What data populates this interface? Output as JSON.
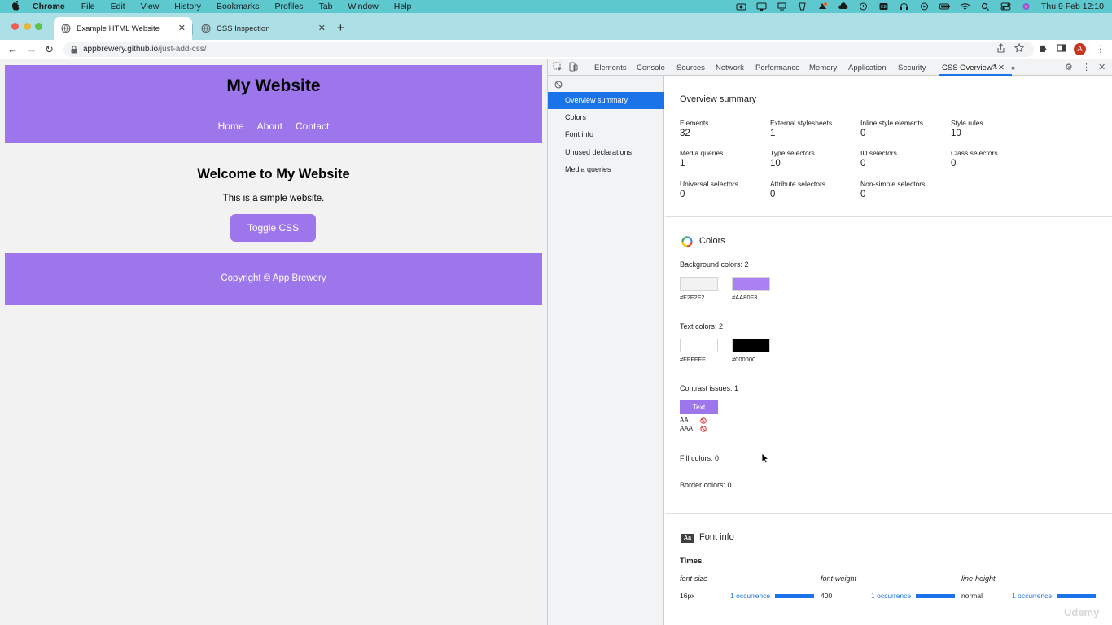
{
  "menubar": {
    "app_name": "Chrome",
    "items": [
      "File",
      "Edit",
      "View",
      "History",
      "Bookmarks",
      "Profiles",
      "Tab",
      "Window",
      "Help"
    ],
    "datetime": "Thu 9 Feb  12:10"
  },
  "browser": {
    "tabs": [
      {
        "title": "Example HTML Website",
        "active": true
      },
      {
        "title": "CSS Inspection",
        "active": false
      }
    ],
    "url_host": "appbrewery.github.io",
    "url_path": "/just-add-css/",
    "profile_initial": "A"
  },
  "site": {
    "title": "My Website",
    "nav": [
      "Home",
      "About",
      "Contact"
    ],
    "heading": "Welcome to My Website",
    "text": "This is a simple website.",
    "button": "Toggle CSS",
    "footer": "Copyright © App Brewery",
    "accent_color": "#AA80F3",
    "background_color": "#F2F2F2"
  },
  "devtools": {
    "tabs": [
      "Elements",
      "Console",
      "Sources",
      "Network",
      "Performance",
      "Memory",
      "Application",
      "Security",
      "CSS Overview"
    ],
    "active_tab": "CSS Overview",
    "sidebar": [
      "Overview summary",
      "Colors",
      "Font info",
      "Unused declarations",
      "Media queries"
    ],
    "selected_sidebar": "Overview summary",
    "overview": {
      "title": "Overview summary",
      "stats": [
        {
          "label": "Elements",
          "value": "32"
        },
        {
          "label": "External stylesheets",
          "value": "1"
        },
        {
          "label": "Inline style elements",
          "value": "0"
        },
        {
          "label": "Style rules",
          "value": "10"
        },
        {
          "label": "Media queries",
          "value": "1"
        },
        {
          "label": "Type selectors",
          "value": "10"
        },
        {
          "label": "ID selectors",
          "value": "0"
        },
        {
          "label": "Class selectors",
          "value": "0"
        },
        {
          "label": "Universal selectors",
          "value": "0"
        },
        {
          "label": "Attribute selectors",
          "value": "0"
        },
        {
          "label": "Non-simple selectors",
          "value": "0"
        }
      ]
    },
    "colors": {
      "title": "Colors",
      "background_label": "Background colors: 2",
      "background": [
        {
          "hex": "#F2F2F2",
          "label": "#F2F2F2"
        },
        {
          "hex": "#AA80F3",
          "label": "#AA80F3"
        }
      ],
      "text_label": "Text colors: 2",
      "text": [
        {
          "hex": "#FFFFFF",
          "label": "#FFFFFF"
        },
        {
          "hex": "#000000",
          "label": "#000000"
        }
      ],
      "contrast_label": "Contrast issues: 1",
      "contrast_chip": "Text",
      "levels": [
        "AA",
        "AAA"
      ],
      "fill_label": "Fill colors: 0",
      "border_label": "Border colors: 0"
    },
    "font_info": {
      "title": "Font info",
      "icon_text": "Aa",
      "font": "Times",
      "columns": [
        "font-size",
        "font-weight",
        "line-height"
      ],
      "values": [
        "16px",
        "400",
        "normal"
      ],
      "occurrence": "1 occurrence"
    }
  },
  "watermark": "Udemy"
}
